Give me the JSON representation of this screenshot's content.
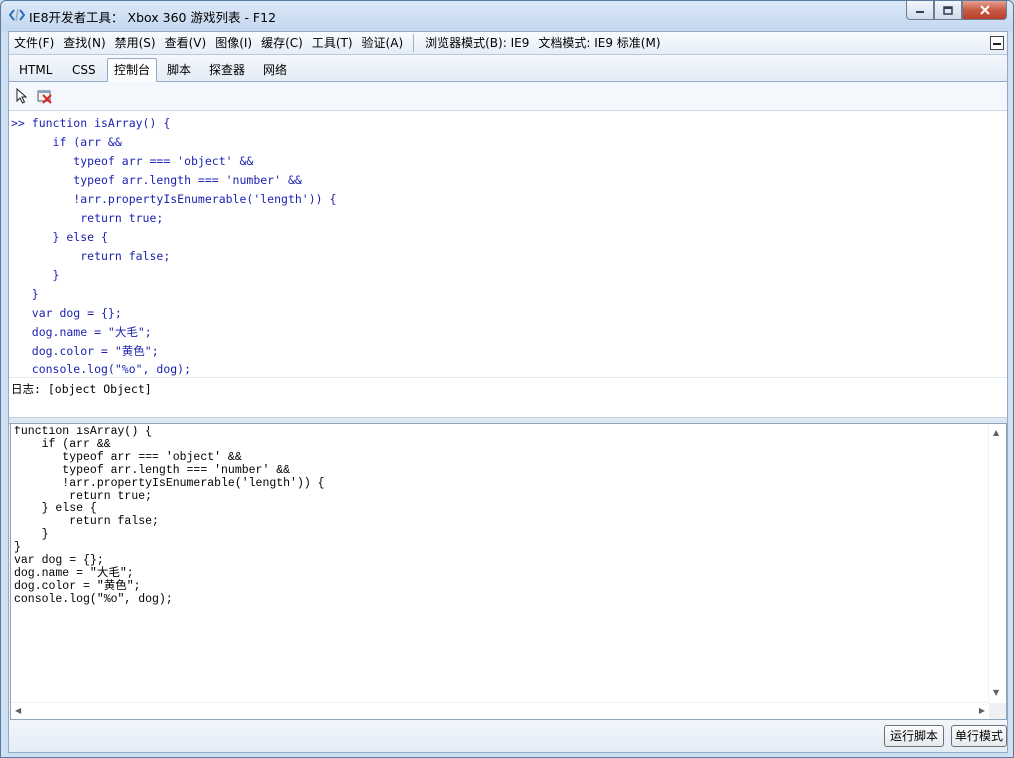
{
  "window": {
    "title": "IE8开发者工具： Xbox 360 游戏列表 - F12"
  },
  "menubar": {
    "items": [
      "文件(F)",
      "查找(N)",
      "禁用(S)",
      "查看(V)",
      "图像(I)",
      "缓存(C)",
      "工具(T)",
      "验证(A)"
    ],
    "browser_mode_label": "浏览器模式(B):",
    "browser_mode_value": "IE9",
    "doc_mode_label": "文档模式:",
    "doc_mode_value": "IE9 标准(M)"
  },
  "tabs": [
    {
      "label": "HTML",
      "active": false
    },
    {
      "label": "CSS",
      "active": false
    },
    {
      "label": "控制台",
      "active": true
    },
    {
      "label": "脚本",
      "active": false
    },
    {
      "label": "探查器",
      "active": false
    },
    {
      "label": "网络",
      "active": false
    }
  ],
  "icons": {
    "select": "cursor-icon",
    "clear": "clear-console-icon"
  },
  "console": {
    "lines": [
      ">> function isArray() {",
      "      if (arr &&",
      "         typeof arr === 'object' &&",
      "         typeof arr.length === 'number' &&",
      "         !arr.propertyIsEnumerable('length')) {",
      "          return true;",
      "      } else {",
      "          return false;",
      "      }",
      "   }",
      "   var dog = {};",
      "   dog.name = \"大毛\";",
      "   dog.color = \"黄色\";",
      "   console.log(\"%o\", dog);"
    ],
    "log": "日志: [object Object]"
  },
  "editor": {
    "code": "function isArray() {\n    if (arr &&\n       typeof arr === 'object' &&\n       typeof arr.length === 'number' &&\n       !arr.propertyIsEnumerable('length')) {\n        return true;\n    } else {\n        return false;\n    }\n}\nvar dog = {};\ndog.name = \"大毛\";\ndog.color = \"黄色\";\nconsole.log(\"%o\", dog);"
  },
  "buttons": {
    "run": "运行脚本",
    "single_line": "单行模式"
  },
  "colors": {
    "console_text": "#1a1fb0",
    "frame_bg": "#cfe0f2"
  }
}
